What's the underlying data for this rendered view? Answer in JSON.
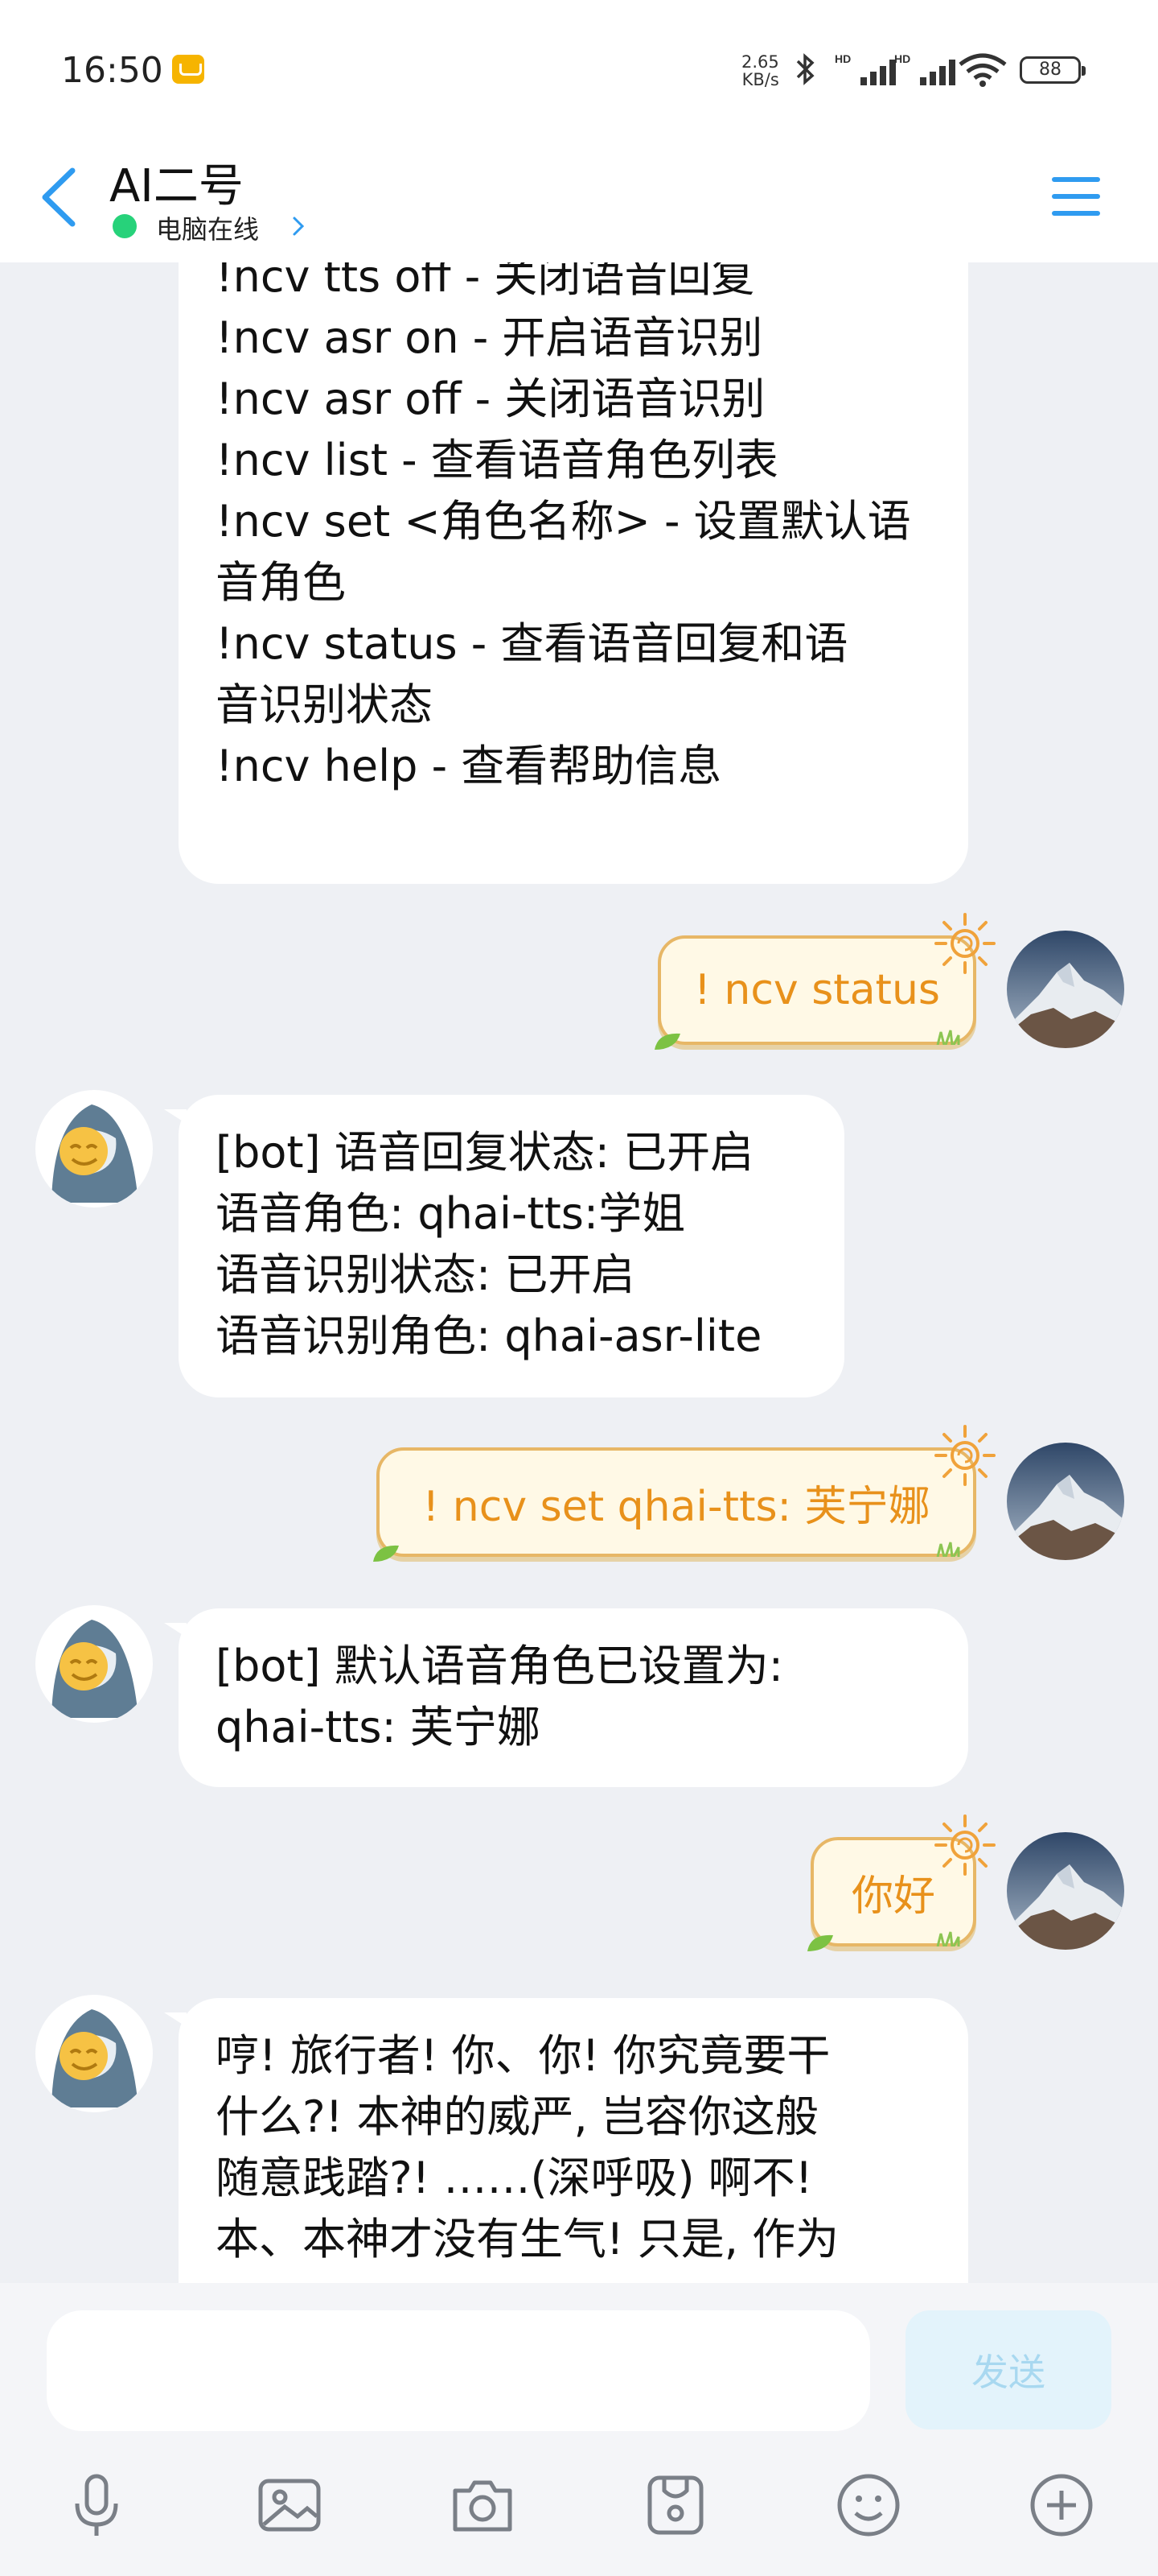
{
  "status_bar": {
    "time": "16:50",
    "network_speed_value": "2.65",
    "network_speed_unit": "KB/s",
    "battery": "88",
    "icons": [
      "notification-icon",
      "bluetooth-icon",
      "signal-hd-icon",
      "signal-hd-icon",
      "wifi-icon",
      "battery-icon"
    ]
  },
  "header": {
    "title": "AI二号",
    "subtitle": "电脑在线"
  },
  "messages": [
    {
      "sender": "bot",
      "lines": [
        "!ncv tts off - 关闭语音回复",
        "!ncv asr on - 开启语音识别",
        "!ncv asr off - 关闭语音识别",
        "!ncv list - 查看语音角色列表",
        "!ncv set <角色名称> - 设置默认语",
        "音角色",
        "!ncv status - 查看语音回复和语",
        "音识别状态",
        "!ncv help - 查看帮助信息"
      ]
    },
    {
      "sender": "me",
      "text": "! ncv status"
    },
    {
      "sender": "bot",
      "lines": [
        "[bot] 语音回复状态: 已开启",
        "语音角色: qhai-tts:学姐",
        "语音识别状态: 已开启",
        "语音识别角色: qhai-asr-lite"
      ]
    },
    {
      "sender": "me",
      "text": "! ncv set qhai-tts: 芙宁娜"
    },
    {
      "sender": "bot",
      "lines": [
        "[bot] 默认语音角色已设置为:",
        "qhai-tts: 芙宁娜"
      ]
    },
    {
      "sender": "me",
      "text": "你好"
    },
    {
      "sender": "bot",
      "lines": [
        "哼! 旅行者! 你、你! 你究竟要干",
        "什么?! 本神的威严, 岂容你这般",
        "随意践踏?! ……(深呼吸) 啊不!",
        "本、本神才没有生气! 只是, 作为"
      ]
    }
  ],
  "input": {
    "placeholder": "",
    "send_label": "发送"
  },
  "toolbar": [
    "microphone-icon",
    "image-icon",
    "camera-icon",
    "sticker-pack-icon",
    "emoji-icon",
    "plus-icon"
  ],
  "colors": {
    "accent": "#2f9bf0",
    "online": "#27d27a",
    "outgoing_text": "#e8911b",
    "outgoing_border": "#e7b766",
    "background": "#eef0f4"
  }
}
